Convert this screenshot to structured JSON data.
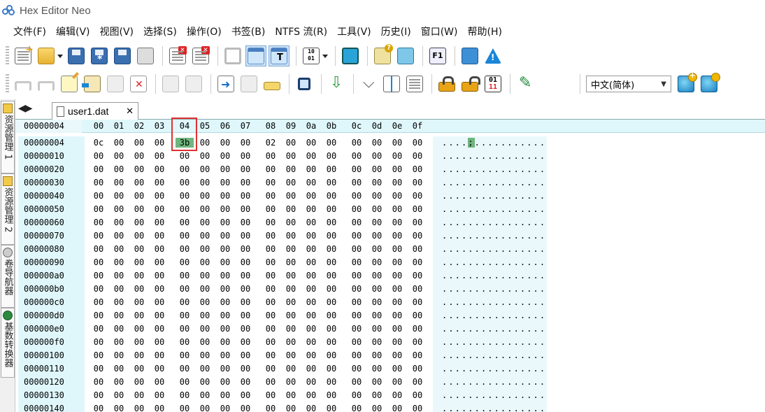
{
  "window": {
    "title": "Hex Editor Neo"
  },
  "menu": [
    "文件(F)",
    "编辑(V)",
    "视图(V)",
    "选择(S)",
    "操作(O)",
    "书签(B)",
    "NTFS 流(R)",
    "工具(V)",
    "历史(I)",
    "窗口(W)",
    "帮助(H)"
  ],
  "toolbar1": {
    "icons": [
      "new-document-icon",
      "open-folder-icon",
      "save-icon",
      "save-as-icon",
      "save-all-icon",
      "print-icon",
      "close-document-icon",
      "close-all-icon",
      "refresh-icon",
      "view-window-icon",
      "view-text-icon",
      "binary-view-icon",
      "monitor-icon",
      "feedback-mail-icon",
      "chat-help-icon",
      "f1-help-icon",
      "book-icon",
      "info-icon"
    ],
    "f1_label": "F1"
  },
  "toolbar2": {
    "icons": [
      "undo-icon",
      "redo-icon",
      "edit-note-icon",
      "paste-icon",
      "copy-icon",
      "delete-icon",
      "disabled-edit-icon",
      "disabled-copy-icon",
      "insert-icon",
      "export-icon",
      "ruler-icon",
      "find-icon",
      "download-icon",
      "funnel-icon",
      "split-icon",
      "column-icon",
      "lock-icon",
      "unlock-icon",
      "bits-icon",
      "pen-icon"
    ],
    "bits_top": "01",
    "bits_bottom": "11",
    "language": "中文(简体)",
    "globe_icons": [
      "add-globe-icon",
      "globe-settings-icon"
    ]
  },
  "side_tabs": [
    {
      "label": "资源管理 1",
      "icon": "explorer-icon"
    },
    {
      "label": "资源管理 2",
      "icon": "explorer-icon"
    },
    {
      "label": "卷导航器",
      "icon": "volume-icon"
    },
    {
      "label": "基数转换器",
      "icon": "converter-icon"
    }
  ],
  "document_tab": {
    "name": "user1.dat",
    "close": "✕"
  },
  "nav_arrows": "◀▶",
  "hex": {
    "header_address": "00000004",
    "columns": [
      "00",
      "01",
      "02",
      "03",
      "04",
      "05",
      "06",
      "07",
      "08",
      "09",
      "0a",
      "0b",
      "0c",
      "0d",
      "0e",
      "0f"
    ],
    "selected_column": "04",
    "rows": [
      {
        "addr": "00000004",
        "bytes": [
          "0c",
          "00",
          "00",
          "00",
          "3b",
          "00",
          "00",
          "00",
          "02",
          "00",
          "00",
          "00",
          "00",
          "00",
          "00",
          "00"
        ],
        "ascii_pre": "....",
        "ascii_hl": ";",
        "ascii_post": "..........."
      },
      {
        "addr": "00000010",
        "bytes": [
          "00",
          "00",
          "00",
          "00",
          "00",
          "00",
          "00",
          "00",
          "00",
          "00",
          "00",
          "00",
          "00",
          "00",
          "00",
          "00"
        ],
        "ascii": "................"
      },
      {
        "addr": "00000020",
        "bytes": [
          "00",
          "00",
          "00",
          "00",
          "00",
          "00",
          "00",
          "00",
          "00",
          "00",
          "00",
          "00",
          "00",
          "00",
          "00",
          "00"
        ],
        "ascii": "................"
      },
      {
        "addr": "00000030",
        "bytes": [
          "00",
          "00",
          "00",
          "00",
          "00",
          "00",
          "00",
          "00",
          "00",
          "00",
          "00",
          "00",
          "00",
          "00",
          "00",
          "00"
        ],
        "ascii": "................"
      },
      {
        "addr": "00000040",
        "bytes": [
          "00",
          "00",
          "00",
          "00",
          "00",
          "00",
          "00",
          "00",
          "00",
          "00",
          "00",
          "00",
          "00",
          "00",
          "00",
          "00"
        ],
        "ascii": "................"
      },
      {
        "addr": "00000050",
        "bytes": [
          "00",
          "00",
          "00",
          "00",
          "00",
          "00",
          "00",
          "00",
          "00",
          "00",
          "00",
          "00",
          "00",
          "00",
          "00",
          "00"
        ],
        "ascii": "................"
      },
      {
        "addr": "00000060",
        "bytes": [
          "00",
          "00",
          "00",
          "00",
          "00",
          "00",
          "00",
          "00",
          "00",
          "00",
          "00",
          "00",
          "00",
          "00",
          "00",
          "00"
        ],
        "ascii": "................"
      },
      {
        "addr": "00000070",
        "bytes": [
          "00",
          "00",
          "00",
          "00",
          "00",
          "00",
          "00",
          "00",
          "00",
          "00",
          "00",
          "00",
          "00",
          "00",
          "00",
          "00"
        ],
        "ascii": "................"
      },
      {
        "addr": "00000080",
        "bytes": [
          "00",
          "00",
          "00",
          "00",
          "00",
          "00",
          "00",
          "00",
          "00",
          "00",
          "00",
          "00",
          "00",
          "00",
          "00",
          "00"
        ],
        "ascii": "................"
      },
      {
        "addr": "00000090",
        "bytes": [
          "00",
          "00",
          "00",
          "00",
          "00",
          "00",
          "00",
          "00",
          "00",
          "00",
          "00",
          "00",
          "00",
          "00",
          "00",
          "00"
        ],
        "ascii": "................"
      },
      {
        "addr": "000000a0",
        "bytes": [
          "00",
          "00",
          "00",
          "00",
          "00",
          "00",
          "00",
          "00",
          "00",
          "00",
          "00",
          "00",
          "00",
          "00",
          "00",
          "00"
        ],
        "ascii": "................"
      },
      {
        "addr": "000000b0",
        "bytes": [
          "00",
          "00",
          "00",
          "00",
          "00",
          "00",
          "00",
          "00",
          "00",
          "00",
          "00",
          "00",
          "00",
          "00",
          "00",
          "00"
        ],
        "ascii": "................"
      },
      {
        "addr": "000000c0",
        "bytes": [
          "00",
          "00",
          "00",
          "00",
          "00",
          "00",
          "00",
          "00",
          "00",
          "00",
          "00",
          "00",
          "00",
          "00",
          "00",
          "00"
        ],
        "ascii": "................"
      },
      {
        "addr": "000000d0",
        "bytes": [
          "00",
          "00",
          "00",
          "00",
          "00",
          "00",
          "00",
          "00",
          "00",
          "00",
          "00",
          "00",
          "00",
          "00",
          "00",
          "00"
        ],
        "ascii": "................"
      },
      {
        "addr": "000000e0",
        "bytes": [
          "00",
          "00",
          "00",
          "00",
          "00",
          "00",
          "00",
          "00",
          "00",
          "00",
          "00",
          "00",
          "00",
          "00",
          "00",
          "00"
        ],
        "ascii": "................"
      },
      {
        "addr": "000000f0",
        "bytes": [
          "00",
          "00",
          "00",
          "00",
          "00",
          "00",
          "00",
          "00",
          "00",
          "00",
          "00",
          "00",
          "00",
          "00",
          "00",
          "00"
        ],
        "ascii": "................"
      },
      {
        "addr": "00000100",
        "bytes": [
          "00",
          "00",
          "00",
          "00",
          "00",
          "00",
          "00",
          "00",
          "00",
          "00",
          "00",
          "00",
          "00",
          "00",
          "00",
          "00"
        ],
        "ascii": "................"
      },
      {
        "addr": "00000110",
        "bytes": [
          "00",
          "00",
          "00",
          "00",
          "00",
          "00",
          "00",
          "00",
          "00",
          "00",
          "00",
          "00",
          "00",
          "00",
          "00",
          "00"
        ],
        "ascii": "................"
      },
      {
        "addr": "00000120",
        "bytes": [
          "00",
          "00",
          "00",
          "00",
          "00",
          "00",
          "00",
          "00",
          "00",
          "00",
          "00",
          "00",
          "00",
          "00",
          "00",
          "00"
        ],
        "ascii": "................"
      },
      {
        "addr": "00000130",
        "bytes": [
          "00",
          "00",
          "00",
          "00",
          "00",
          "00",
          "00",
          "00",
          "00",
          "00",
          "00",
          "00",
          "00",
          "00",
          "00",
          "00"
        ],
        "ascii": "................"
      },
      {
        "addr": "00000140",
        "bytes": [
          "00",
          "00",
          "00",
          "00",
          "00",
          "00",
          "00",
          "00",
          "00",
          "00",
          "00",
          "00",
          "00",
          "00",
          "00",
          "00"
        ],
        "ascii": "................"
      }
    ]
  },
  "colors": {
    "selection": "#6fb57e",
    "highlight_box": "#e03030",
    "hex_header_bg": "#dff7fb"
  }
}
